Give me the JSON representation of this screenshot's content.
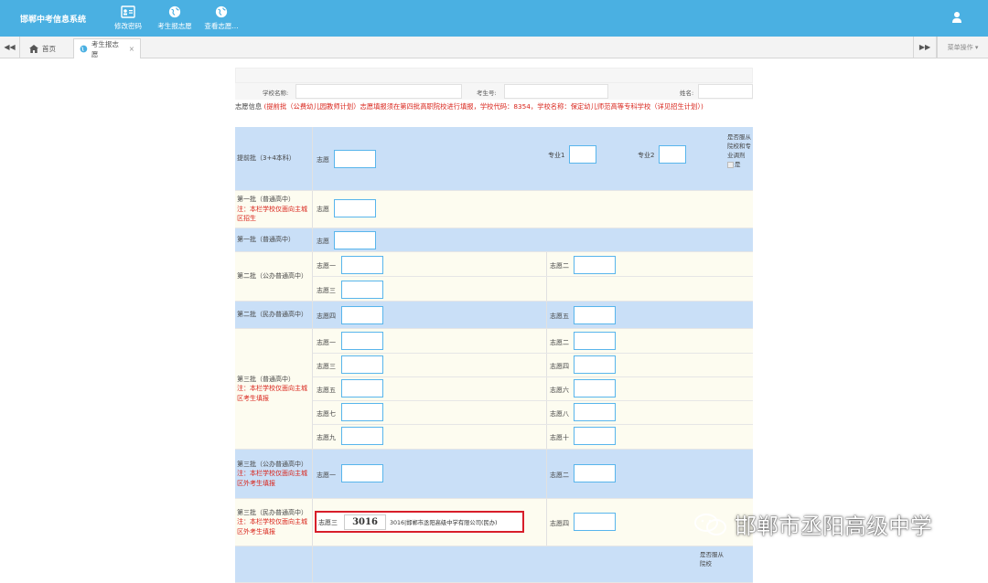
{
  "app_title": "邯郸中考信息系统",
  "nav": [
    {
      "label": "修改密码",
      "icon": "id-card-icon"
    },
    {
      "label": "考生报志愿",
      "icon": "globe-icon"
    },
    {
      "label": "查看志愿...",
      "icon": "globe-icon"
    }
  ],
  "user_icon": "user-icon",
  "tabs": {
    "home": "首页",
    "current": "考生报志愿",
    "close": "×",
    "menu": "菜单操作"
  },
  "info": {
    "school": "学校名称:",
    "exam_no": "考生号:",
    "name": "姓名:"
  },
  "notice": {
    "lead": "志愿信息",
    "red": "(提前批（公费幼儿园教师计划）志愿填报须在第四批高职院校进行填报，学校代码：8354，学校名称：保定幼儿师范高等专科学校（详见招生计划）)"
  },
  "sections": {
    "s1": {
      "category": "提前批（3+4本科）",
      "choice": "志愿",
      "major1": "专业1",
      "major2": "专业2",
      "adjust": "是否服从院校和专业调剂",
      "yes": "是"
    },
    "s2": {
      "category": "第一批（普通高中）",
      "note": "注：本栏学校仅面向主城区招生",
      "choice": "志愿"
    },
    "s3": {
      "category": "第一批（普通高中）",
      "choice": "志愿"
    },
    "s4": {
      "category": "第二批（公办普通高中）",
      "c1": "志愿一",
      "c2": "志愿二",
      "c3": "志愿三"
    },
    "s5": {
      "category": "第二批（民办普通高中）",
      "c4": "志愿四",
      "c5": "志愿五"
    },
    "s6": {
      "category": "第三批（普通高中）",
      "note": "注：本栏学校仅面向主城区考生填报",
      "c1": "志愿一",
      "c2": "志愿二",
      "c3": "志愿三",
      "c4": "志愿四",
      "c5": "志愿五",
      "c6": "志愿六",
      "c7": "志愿七",
      "c8": "志愿八",
      "c9": "志愿九",
      "c10": "志愿十"
    },
    "s7": {
      "category": "第三批（公办普通高中）",
      "note": "注：本栏学校仅面向主城区外考生填报",
      "c1": "志愿一",
      "c2": "志愿二"
    },
    "s8": {
      "category": "第三批（民办普通高中）",
      "note": "注：本栏学校仅面向主城区外考生填报",
      "c3": "志愿三",
      "code": "3016",
      "school": "3016|邯郸市丞阳高级中学有限公司(民办)",
      "c4": "志愿四"
    },
    "s9": {
      "adjust": "是否服从院校"
    }
  },
  "watermark": "邯郸市丞阳高级中学",
  "colors": {
    "header": "#4ab0e2",
    "blue_row": "#c9dff7",
    "cream_row": "#fdfcf0",
    "note_red": "#d9241b",
    "highlight": "#d81e2a"
  }
}
